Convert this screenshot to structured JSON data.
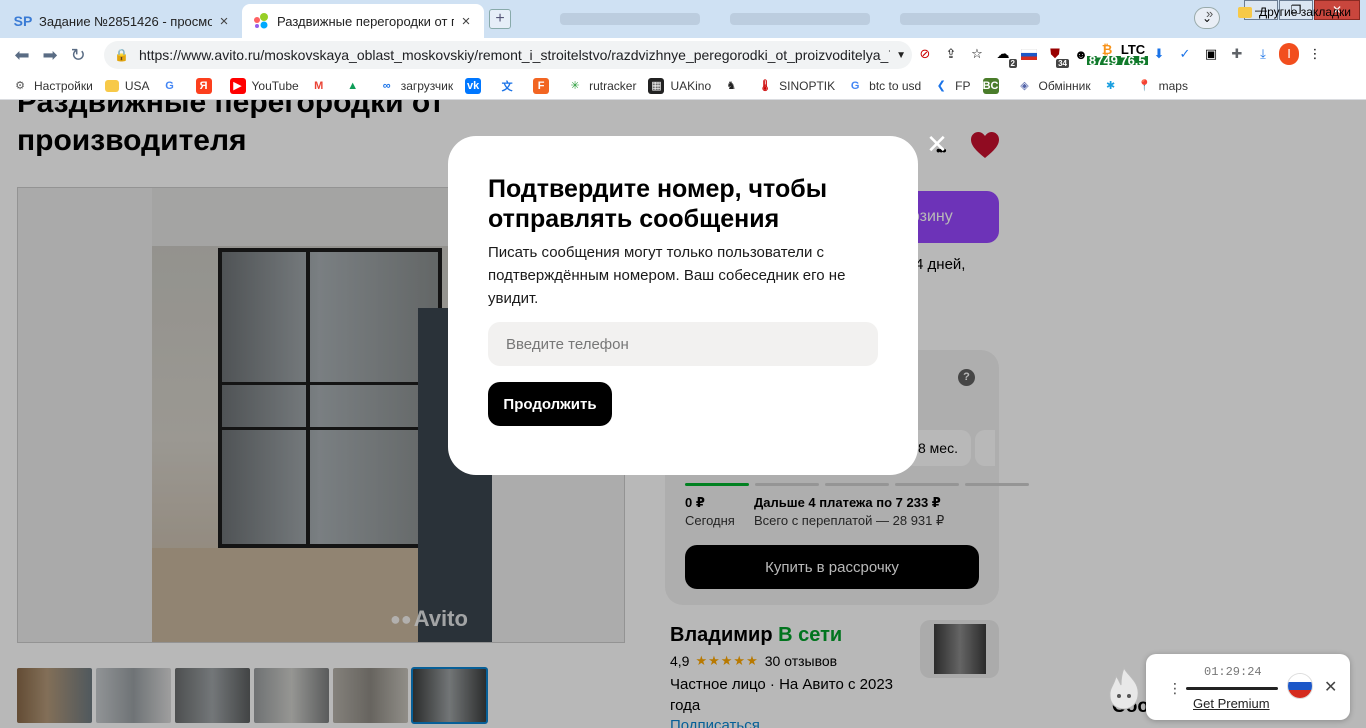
{
  "browser": {
    "tabs": [
      {
        "title": "Задание №2851426 - просмотр з",
        "favicon": "SP",
        "active": false
      },
      {
        "title": "Раздвижные перегородки от про",
        "favicon": "avito-icon",
        "active": true
      }
    ],
    "url": "https://www.avito.ru/moskovskaya_oblast_moskovskiy/remont_i_stroitelstvo/razdvizhnye_peregorodki_ot_proizvoditelya_7...",
    "profile_initial": "I",
    "extensions": {
      "cloud_count": "2",
      "shield_count": "34",
      "btc_price": "87498",
      "ltc_label": "LTC",
      "ltc_price": "76.5"
    },
    "bookmarks": [
      {
        "label": "Настройки",
        "icon": "gear-icon"
      },
      {
        "label": "USA",
        "icon": "folder-icon"
      },
      {
        "label": "",
        "icon": "google-icon"
      },
      {
        "label": "",
        "icon": "yandex-icon"
      },
      {
        "label": "YouTube",
        "icon": "youtube-icon"
      },
      {
        "label": "",
        "icon": "gmail-icon"
      },
      {
        "label": "",
        "icon": "drive-icon"
      },
      {
        "label": "загрузчик",
        "icon": "infinity-icon"
      },
      {
        "label": "",
        "icon": "vk-icon"
      },
      {
        "label": "",
        "icon": "translate-icon"
      },
      {
        "label": "",
        "icon": "f-icon"
      },
      {
        "label": "rutracker",
        "icon": "rutracker-icon"
      },
      {
        "label": "UAKino",
        "icon": "uakino-icon"
      },
      {
        "label": "",
        "icon": "chess-icon"
      },
      {
        "label": "SINOPTIK",
        "icon": "thermometer-icon"
      },
      {
        "label": "btc to usd",
        "icon": "google-icon"
      },
      {
        "label": "FP",
        "icon": "fp-icon"
      },
      {
        "label": "",
        "icon": "bc-icon"
      },
      {
        "label": "Обмінник",
        "icon": "exchange-icon"
      },
      {
        "label": "",
        "icon": "kyivstar-icon"
      },
      {
        "label": "maps",
        "icon": "maps-pin-icon"
      }
    ],
    "bookmarks_more": "»",
    "other_bookmarks": "Другие закладки"
  },
  "listing": {
    "title": "Раздвижные перегородки от производителя",
    "gallery_watermark": "Avito",
    "thumbnail_count": 6,
    "selected_thumbnail": 6,
    "cart_button_partial": "орзину",
    "delivery_partial": "т 4 дней,",
    "installment": {
      "term_partial": "8 мес.",
      "help_mark": "?",
      "today_amount": "0 ₽",
      "today_label": "Сегодня",
      "next_payments": "Дальше 4 платежа по 7 233 ₽",
      "total": "Всего с переплатой — 28 931 ₽",
      "button": "Купить в рассрочку",
      "progress_steps_total": 5,
      "progress_steps_done": 1
    },
    "seller": {
      "name": "Владимир",
      "status": "В сети",
      "rating": "4,9",
      "stars": "★★★★★",
      "reviews": "30 отзывов",
      "type": "Частное лицо · На Авито с 2023 года",
      "subscribe": "Подписаться"
    },
    "partial_right_text": "Соо"
  },
  "modal": {
    "title": "Подтвердите номер, чтобы отправлять сообщения",
    "text": "Писать сообщения могут только пользователи с подтверждённым номером. Ваш собеседник его не увидит.",
    "phone_placeholder": "Введите телефон",
    "phone_value": "",
    "continue_button": "Продолжить",
    "close_icon": "close-icon"
  },
  "vpn_widget": {
    "timer": "01:29:24",
    "premium_link": "Get Premium",
    "flag": "russia-flag",
    "mascot": "flame-mascot-icon"
  },
  "colors": {
    "accent_purple": "#9747ff",
    "online_green": "#02a12a",
    "heart": "#c8102e",
    "tabbar": "#cfe1f3"
  }
}
